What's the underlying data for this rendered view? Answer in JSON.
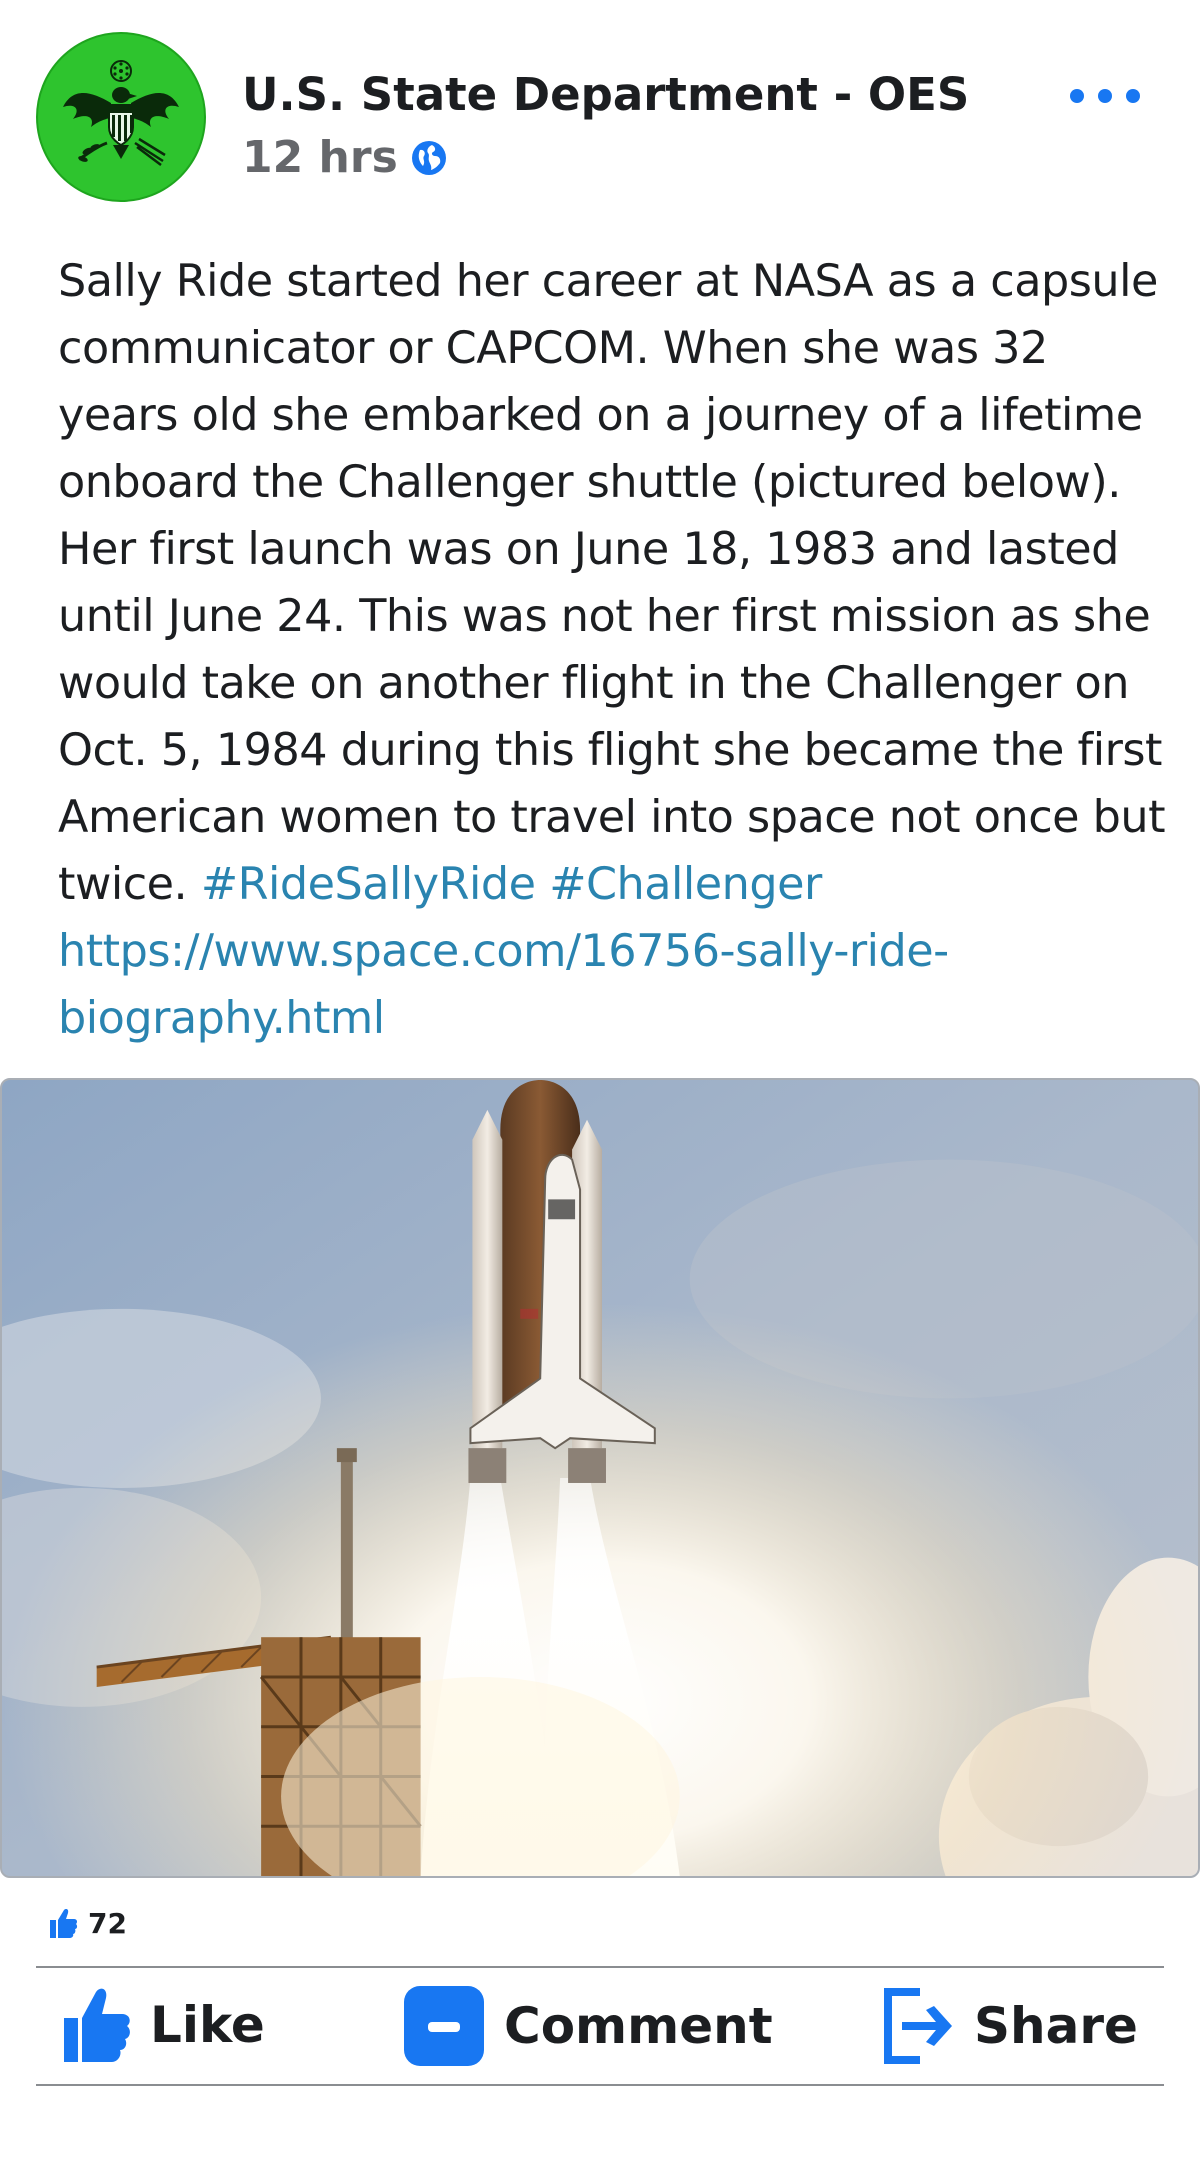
{
  "header": {
    "page_name": "U.S. State Department - OES",
    "time": "12 hrs",
    "privacy_icon": "globe-icon",
    "menu_icon": "more-options-icon"
  },
  "post": {
    "lines": [
      "Sally Ride started her career at NASA as a capsule",
      "communicator or CAPCOM. When she was 32",
      "years old she embarked on a journey of a lifetime",
      "onboard the Challenger shuttle (pictured below).",
      "Her first launch was on June 18, 1983 and lasted",
      "until June 24. This was not her first mission as she",
      "would take on another flight in the Challenger on",
      "Oct. 5, 1984 during this flight she became the first",
      "American women to travel into space not once but"
    ],
    "last_line_text": "twice. ",
    "hashtag_1": "#RideSallyRide",
    "hashtag_2": "#Challenger",
    "link_line_1": "https://www.space.com/16756-sally-ride-",
    "link_line_2": "biography.html"
  },
  "photo": {
    "description_icon": "space-shuttle-launch-photo"
  },
  "reactions": {
    "icon": "like-thumb-icon",
    "count": "72"
  },
  "actions": {
    "like_label": "Like",
    "comment_label": "Comment",
    "share_label": "Share"
  },
  "colors": {
    "accent": "#1877f2",
    "link": "#2a84b0",
    "avatar_bg": "#2ec42e",
    "meta": "#65676b"
  }
}
